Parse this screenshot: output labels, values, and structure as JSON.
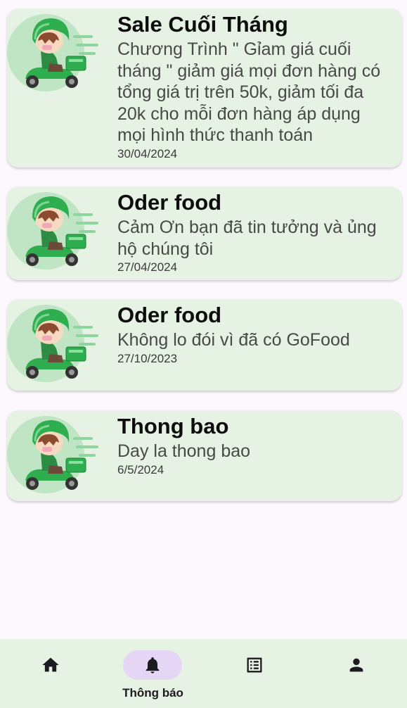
{
  "notifications": [
    {
      "title": "Sale Cuối Tháng",
      "body": "Chương Trình \" Gỉam giá cuối tháng \" giảm giá mọi đơn hàng có tổng giá trị trên 50k, giảm tối đa 20k cho mỗi đơn hàng áp dụng mọi hình thức thanh toán",
      "date": "30/04/2024",
      "image_icon": "delivery-scooter-illustration"
    },
    {
      "title": "Oder food",
      "body": "Cảm Ơn bạn đã tin tưởng và ủng hộ chúng tôi",
      "date": "27/04/2024",
      "image_icon": "delivery-scooter-illustration"
    },
    {
      "title": "Oder food",
      "body": "Không lo đói vì đã có GoFood",
      "date": "27/10/2023",
      "image_icon": "delivery-scooter-illustration"
    },
    {
      "title": "Thong bao",
      "body": "Day la thong bao",
      "date": "6/5/2024",
      "image_icon": "delivery-scooter-illustration"
    }
  ],
  "bottom_nav": {
    "items": [
      {
        "icon": "home-icon",
        "label": "",
        "active": false
      },
      {
        "icon": "bell-icon",
        "label": "Thông báo",
        "active": true
      },
      {
        "icon": "list-icon",
        "label": "",
        "active": false
      },
      {
        "icon": "person-icon",
        "label": "",
        "active": false
      }
    ],
    "active_pill_color": "#e5d6f5",
    "background_color": "#e6f2e3"
  },
  "colors": {
    "card_background": "#e6f2e3",
    "page_background": "#fdf8fd",
    "brand_green": "#2fae4f"
  }
}
